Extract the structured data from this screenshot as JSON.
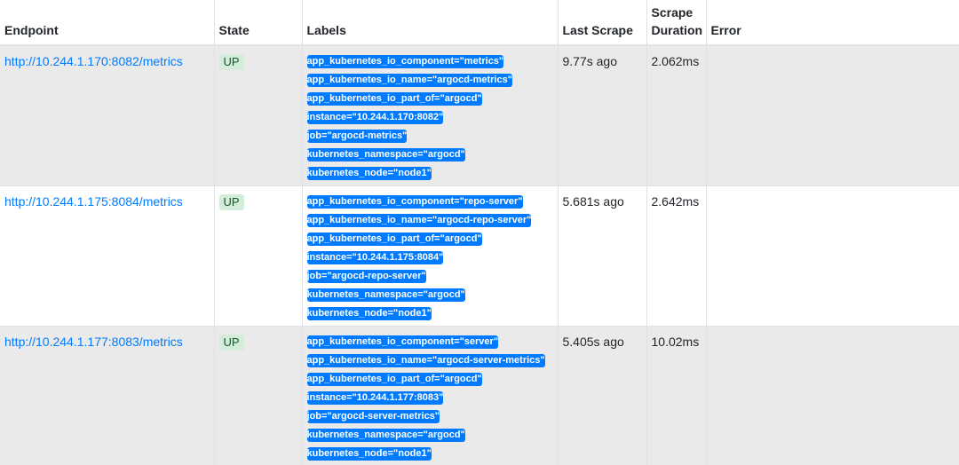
{
  "table": {
    "headers": {
      "endpoint": "Endpoint",
      "state": "State",
      "labels": "Labels",
      "last_scrape": "Last Scrape",
      "scrape_duration": "Scrape Duration",
      "error": "Error"
    },
    "rows": [
      {
        "endpoint": "http://10.244.1.170:8082/metrics",
        "state": "UP",
        "labels": [
          "app_kubernetes_io_component=\"metrics\"",
          "app_kubernetes_io_name=\"argocd-metrics\"",
          "app_kubernetes_io_part_of=\"argocd\"",
          "instance=\"10.244.1.170:8082\"",
          "job=\"argocd-metrics\"",
          "kubernetes_namespace=\"argocd\"",
          "kubernetes_node=\"node1\""
        ],
        "last_scrape": "9.77s ago",
        "scrape_duration": "2.062ms",
        "error": ""
      },
      {
        "endpoint": "http://10.244.1.175:8084/metrics",
        "state": "UP",
        "labels": [
          "app_kubernetes_io_component=\"repo-server\"",
          "app_kubernetes_io_name=\"argocd-repo-server\"",
          "app_kubernetes_io_part_of=\"argocd\"",
          "instance=\"10.244.1.175:8084\"",
          "job=\"argocd-repo-server\"",
          "kubernetes_namespace=\"argocd\"",
          "kubernetes_node=\"node1\""
        ],
        "last_scrape": "5.681s ago",
        "scrape_duration": "2.642ms",
        "error": ""
      },
      {
        "endpoint": "http://10.244.1.177:8083/metrics",
        "state": "UP",
        "labels": [
          "app_kubernetes_io_component=\"server\"",
          "app_kubernetes_io_name=\"argocd-server-metrics\"",
          "app_kubernetes_io_part_of=\"argocd\"",
          "instance=\"10.244.1.177:8083\"",
          "job=\"argocd-server-metrics\"",
          "kubernetes_namespace=\"argocd\"",
          "kubernetes_node=\"node1\""
        ],
        "last_scrape": "5.405s ago",
        "scrape_duration": "10.02ms",
        "error": ""
      }
    ]
  },
  "colors": {
    "link": "#007bff",
    "label_badge_bg": "#007bff",
    "state_up_bg": "#d4edda",
    "state_up_text": "#155724",
    "odd_row_bg": "#eaeaea"
  }
}
